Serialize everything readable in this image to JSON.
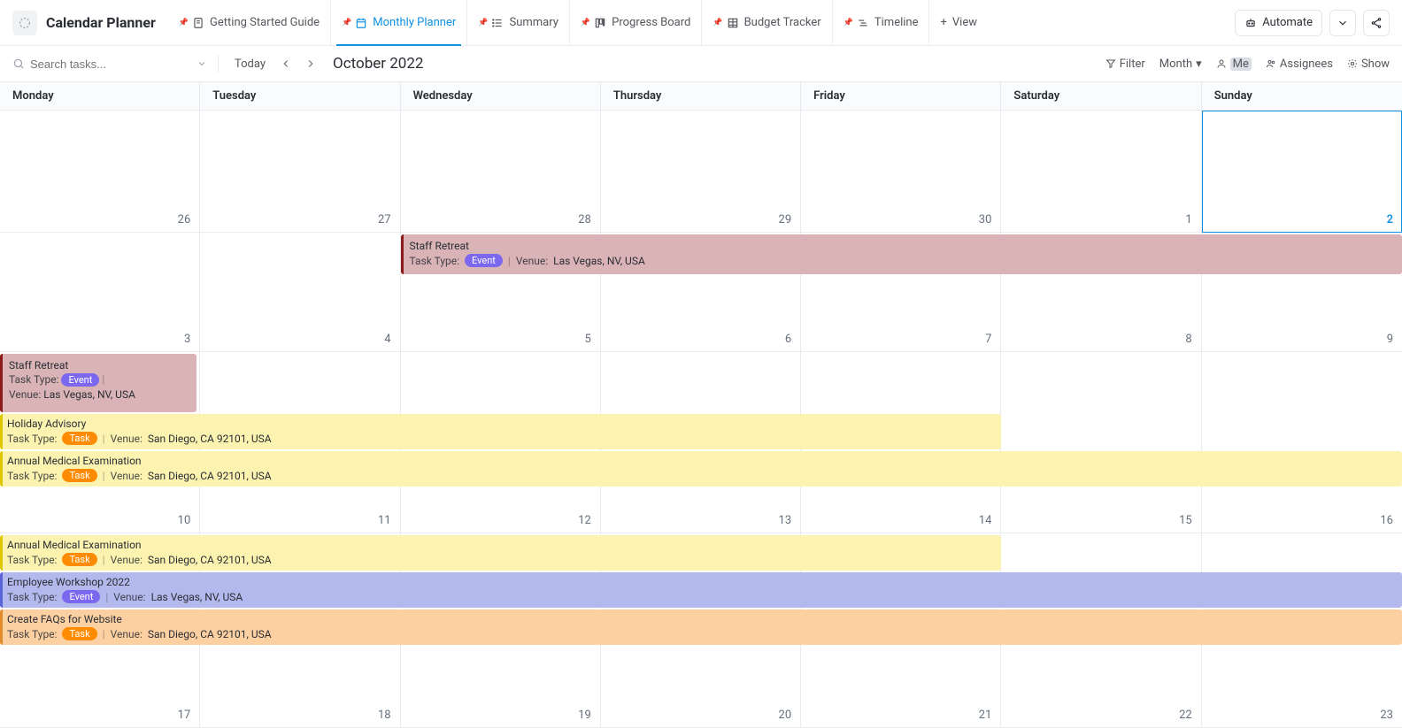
{
  "app": {
    "title": "Calendar Planner"
  },
  "tabs": [
    {
      "label": "Getting Started Guide"
    },
    {
      "label": "Monthly Planner"
    },
    {
      "label": "Summary"
    },
    {
      "label": "Progress Board"
    },
    {
      "label": "Budget Tracker"
    },
    {
      "label": "Timeline"
    }
  ],
  "addview_label": "View",
  "automate_label": "Automate",
  "search": {
    "placeholder": "Search tasks..."
  },
  "toolbar": {
    "today": "Today",
    "month_label": "October 2022",
    "filter": "Filter",
    "month_dropdown": "Month",
    "me": "Me",
    "assignees": "Assignees",
    "show": "Show"
  },
  "day_headers": [
    "Monday",
    "Tuesday",
    "Wednesday",
    "Thursday",
    "Friday",
    "Saturday",
    "Sunday"
  ],
  "weeks": [
    [
      "26",
      "27",
      "28",
      "29",
      "30",
      "1",
      "2"
    ],
    [
      "3",
      "4",
      "5",
      "6",
      "7",
      "8",
      "9"
    ],
    [
      "10",
      "11",
      "12",
      "13",
      "14",
      "15",
      "16"
    ],
    [
      "17",
      "18",
      "19",
      "20",
      "21",
      "22",
      "23"
    ]
  ],
  "today_cell": [
    0,
    6
  ],
  "labels": {
    "task_type": "Task Type:",
    "venue": "Venue:",
    "event_badge": "Event",
    "task_badge": "Task"
  },
  "events": {
    "staff_retreat": {
      "title": "Staff Retreat",
      "venue": "Las Vegas, NV, USA",
      "type": "Event"
    },
    "staff_retreat2": {
      "title": "Staff Retreat",
      "venue": "Las Vegas, NV, USA",
      "type": "Event"
    },
    "holiday_advisory": {
      "title": "Holiday Advisory",
      "venue": "San Diego, CA 92101, USA",
      "type": "Task"
    },
    "annual_medical": {
      "title": "Annual Medical Examination",
      "venue": "San Diego, CA 92101, USA",
      "type": "Task"
    },
    "annual_medical2": {
      "title": "Annual Medical Examination",
      "venue": "San Diego, CA 92101, USA",
      "type": "Task"
    },
    "employee_workshop": {
      "title": "Employee Workshop 2022",
      "venue": "Las Vegas, NV, USA",
      "type": "Event"
    },
    "faqs": {
      "title": "Create FAQs for Website",
      "venue": "San Diego, CA 92101, USA",
      "type": "Task"
    }
  }
}
